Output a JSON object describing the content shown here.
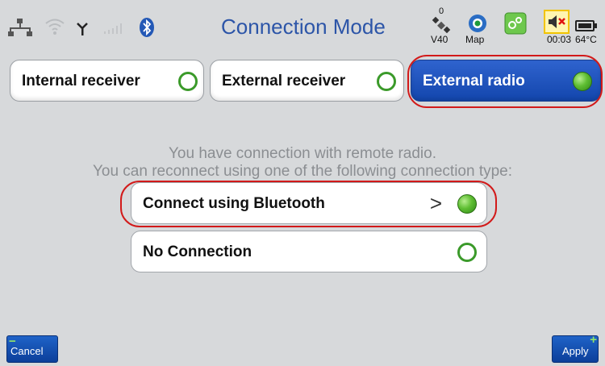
{
  "header": {
    "title": "Connection Mode",
    "satellite_count": "0",
    "satellite_label": "V40",
    "map_label": "Map",
    "timer": "00:03",
    "temperature": "64°C"
  },
  "modes": [
    {
      "label": "Internal receiver",
      "selected": false
    },
    {
      "label": "External receiver",
      "selected": false
    },
    {
      "label": "External radio",
      "selected": true
    }
  ],
  "message": {
    "line1": "You have connection with remote radio.",
    "line2": "You can reconnect using one of the following connection type:"
  },
  "options": [
    {
      "label": "Connect using Bluetooth",
      "chevron": ">",
      "selected": true
    },
    {
      "label": "No Connection",
      "selected": false
    }
  ],
  "footer": {
    "cancel_label": "Cancel",
    "apply_label": "Apply"
  },
  "colors": {
    "accent": "#1a4fbf",
    "highlight": "#d21a1a",
    "radio": "#4caf2a"
  }
}
